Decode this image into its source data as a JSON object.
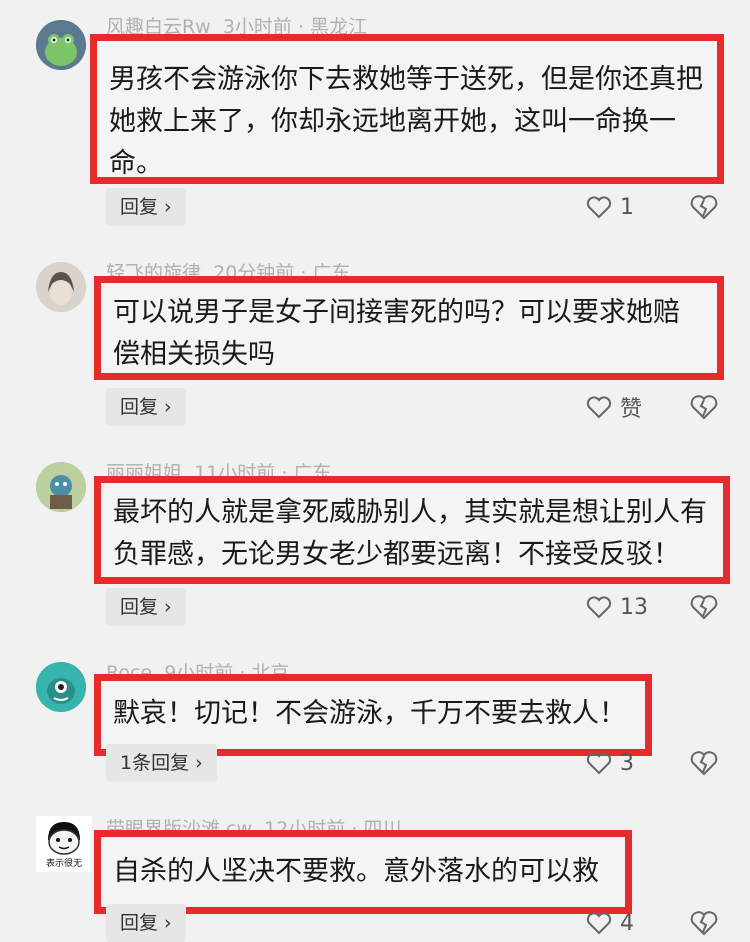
{
  "comments": [
    {
      "user": "风趣白云Rw",
      "time": "3小时前",
      "location": "黑龙江",
      "text": "男孩不会游泳你下去救她等于送死，但是你还真把她救上来了，你却永远地离开她，这叫一命换一命。",
      "reply_label": "回复",
      "likes": "1",
      "avatar_icon": "green-frog-avatar-icon"
    },
    {
      "user": "轻飞的旋律",
      "time": "20分钟前",
      "location": "广东",
      "text": "可以说男子是女子间接害死的吗？可以要求她赔偿相关损失吗",
      "reply_label": "回复",
      "likes": "赞",
      "avatar_icon": "girl-portrait-avatar-icon"
    },
    {
      "user": "丽丽姐姐",
      "time": "11小时前",
      "location": "广东",
      "text": "最坏的人就是拿死威胁别人，其实就是想让别人有负罪感，无论男女老少都要远离！不接受反驳！",
      "reply_label": "回复",
      "likes": "13",
      "avatar_icon": "cartoon-avatar-icon"
    },
    {
      "user": "Roce",
      "time": "9小时前",
      "location": "北京",
      "text": "默哀！切记！不会游泳，千万不要去救人！",
      "reply_label": "1条回复",
      "likes": "3",
      "avatar_icon": "teal-monster-avatar-icon"
    },
    {
      "user": "带眼界版沙滩.cw",
      "time": "12小时前",
      "location": "四川",
      "text": "自杀的人坚决不要救。意外落水的可以救",
      "reply_label": "回复",
      "likes": "4",
      "avatar_icon": "meme-face-avatar-icon",
      "avatar_caption": "表示很无"
    }
  ],
  "colors": {
    "highlight_border": "#e52b2b",
    "background": "#f1f1f1",
    "meta_text": "#b0b0b0"
  }
}
